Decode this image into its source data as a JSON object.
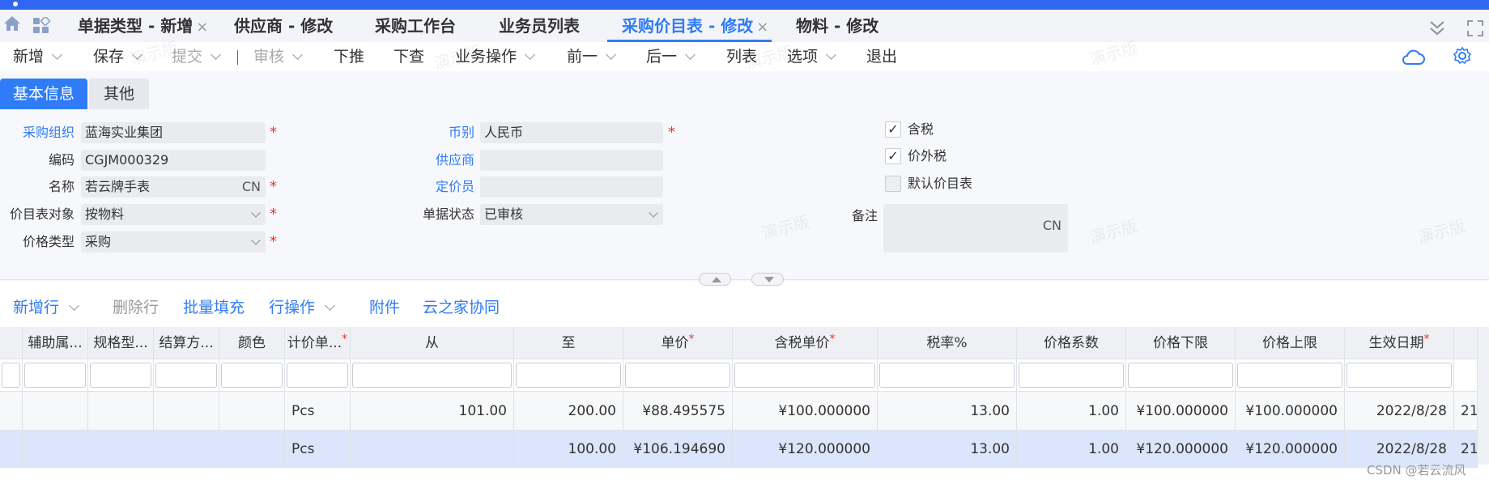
{
  "tabs": [
    {
      "label": "单据类型 - 新增",
      "closable": true,
      "active": false
    },
    {
      "label": "供应商 - 修改",
      "closable": false,
      "active": false
    },
    {
      "label": "采购工作台",
      "closable": false,
      "active": false
    },
    {
      "label": "业务员列表",
      "closable": false,
      "active": false
    },
    {
      "label": "采购价目表 - 修改",
      "closable": true,
      "active": true
    },
    {
      "label": "物料 - 修改",
      "closable": false,
      "active": false
    }
  ],
  "close_glyph": "×",
  "toolbar": {
    "new": "新增",
    "save": "保存",
    "submit": "提交",
    "audit": "审核",
    "push_down": "下推",
    "query_down": "下查",
    "biz_ops": "业务操作",
    "prev": "前一",
    "next": "后一",
    "list": "列表",
    "options": "选项",
    "exit": "退出"
  },
  "form_tabs": {
    "basic": "基本信息",
    "other": "其他"
  },
  "form": {
    "purchase_org": {
      "label": "采购组织",
      "value": "蓝海实业集团"
    },
    "code": {
      "label": "编码",
      "value": "CGJM000329"
    },
    "name": {
      "label": "名称",
      "value": "若云牌手表",
      "suffix": "CN"
    },
    "price_object": {
      "label": "价目表对象",
      "value": "按物料"
    },
    "price_type": {
      "label": "价格类型",
      "value": "采购"
    },
    "currency": {
      "label": "币别",
      "value": "人民币"
    },
    "supplier": {
      "label": "供应商",
      "value": ""
    },
    "pricer": {
      "label": "定价员",
      "value": ""
    },
    "doc_status": {
      "label": "单据状态",
      "value": "已审核"
    },
    "tax_included": {
      "label": "含税",
      "checked": true
    },
    "tax_excluded": {
      "label": "价外税",
      "checked": true
    },
    "default_price_list": {
      "label": "默认价目表",
      "checked": false
    },
    "memo": {
      "label": "备注",
      "value": "",
      "suffix": "CN"
    },
    "required_mark": "*",
    "check_glyph": "✓"
  },
  "watermark": "演示版",
  "grid_toolbar": {
    "add_row": "新增行",
    "delete_row": "删除行",
    "batch_fill": "批量填充",
    "row_ops": "行操作",
    "attachment": "附件",
    "cloud_collab": "云之家协同"
  },
  "grid": {
    "columns": [
      {
        "label": "",
        "required": false
      },
      {
        "label": "辅助属...",
        "required": false
      },
      {
        "label": "规格型...",
        "required": false
      },
      {
        "label": "结算方...",
        "required": false
      },
      {
        "label": "颜色",
        "required": false
      },
      {
        "label": "计价单...",
        "required": true
      },
      {
        "label": "从",
        "required": false
      },
      {
        "label": "至",
        "required": false
      },
      {
        "label": "单价",
        "required": true
      },
      {
        "label": "含税单价",
        "required": true
      },
      {
        "label": "税率%",
        "required": false
      },
      {
        "label": "价格系数",
        "required": false
      },
      {
        "label": "价格下限",
        "required": false
      },
      {
        "label": "价格上限",
        "required": false
      },
      {
        "label": "生效日期",
        "required": true
      },
      {
        "label": "",
        "required": false
      }
    ],
    "rows": [
      [
        "",
        "",
        "",
        "",
        "",
        "Pcs",
        "101.00",
        "200.00",
        "¥88.495575",
        "¥100.000000",
        "13.00",
        "1.00",
        "¥100.000000",
        "¥100.000000",
        "2022/8/28",
        "21"
      ],
      [
        "",
        "",
        "",
        "",
        "",
        "Pcs",
        "",
        "100.00",
        "¥106.194690",
        "¥120.000000",
        "13.00",
        "1.00",
        "¥120.000000",
        "¥120.000000",
        "2022/8/28",
        "21"
      ]
    ]
  },
  "credit": "CSDN @若云流风",
  "colors": {
    "accent": "#2f7cf6",
    "topbar": "#2f66f2",
    "selected_row": "#dbe5fb",
    "required": "#e53935"
  }
}
